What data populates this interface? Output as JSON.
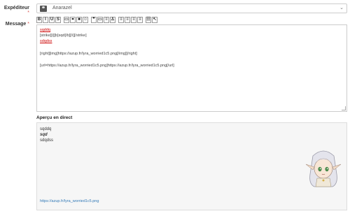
{
  "form": {
    "sender_label": "Expéditeur",
    "message_label": "Message",
    "required_mark": "*",
    "sender_value": "Anarazel"
  },
  "toolbar": {
    "buttons": [
      {
        "name": "bold-button",
        "glyph": "B"
      },
      {
        "name": "italic-button",
        "glyph": "I"
      },
      {
        "name": "underline-button",
        "glyph": "U"
      },
      {
        "name": "strike-button",
        "glyph": "S"
      },
      {
        "name": "image-button",
        "glyph": "▭"
      },
      {
        "name": "link-button",
        "glyph": "⚭"
      },
      {
        "name": "video-button",
        "glyph": "■"
      },
      {
        "name": "emoji-button",
        "glyph": "☺"
      },
      {
        "name": "quote-button",
        "glyph": "❞"
      },
      {
        "name": "spoiler-button",
        "glyph": "▭"
      },
      {
        "name": "list-button",
        "glyph": "≡"
      },
      {
        "name": "user-button",
        "glyph": "♙"
      },
      {
        "name": "align-left-button",
        "glyph": "≡"
      },
      {
        "name": "align-center-button",
        "glyph": "≡"
      },
      {
        "name": "align-right-button",
        "glyph": "≡"
      },
      {
        "name": "justify-button",
        "glyph": "≡"
      },
      {
        "name": "table-button",
        "glyph": "☷"
      },
      {
        "name": "more-button",
        "glyph": "↖"
      }
    ]
  },
  "editor": {
    "lines": [
      "sqddq",
      "[strike][i][b]sqd[/b][/i][/strike]",
      "sdqdss",
      "",
      "[right][img]https://azup.fr/lyra_worried1c5.png[/img][/right]",
      "",
      "[url=https://azup.fr/lyra_worried1c5.png]https://azup.fr/lyra_worried1c5.png[/url]"
    ]
  },
  "preview": {
    "title": "Aperçu en direct",
    "lines": [
      "sqddq",
      "sqd",
      "sdqdss"
    ],
    "link": "https://azup.fr/lyra_worried1c5.png"
  }
}
